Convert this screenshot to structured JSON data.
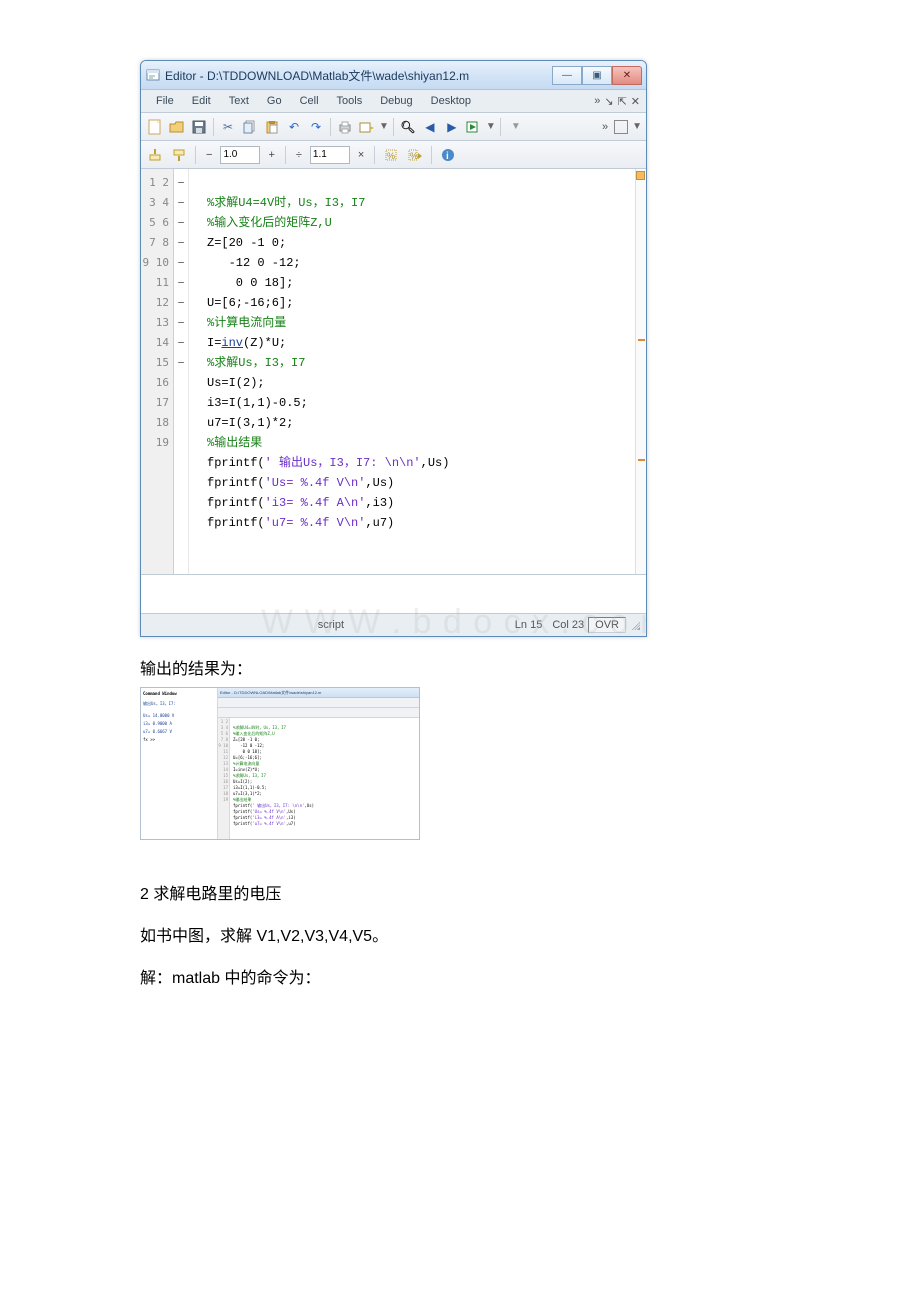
{
  "window": {
    "title": "Editor - D:\\TDDOWNLOAD\\Matlab文件\\wade\\shiyan12.m",
    "menubar": [
      "File",
      "Edit",
      "Text",
      "Go",
      "Cell",
      "Tools",
      "Debug",
      "Desktop"
    ],
    "controls": {
      "minimize": "—",
      "maximize": "▣",
      "close": "✕"
    },
    "toolbar2": {
      "val1": "1.0",
      "val2": "1.1",
      "minus": "−",
      "plus": "+",
      "div": "÷",
      "times": "×"
    },
    "status": {
      "script": "script",
      "ln_label": "Ln",
      "ln": "15",
      "col_label": "Col",
      "col": "23",
      "mode": "OVR"
    }
  },
  "code_lines": [
    {
      "n": "1",
      "fold": "",
      "text": ""
    },
    {
      "n": "2",
      "fold": "",
      "text": "%求解U4=4V时，Us，I3，I7",
      "cls": "comment"
    },
    {
      "n": "3",
      "fold": "",
      "text": "%输入变化后的矩阵Z,U",
      "cls": "comment"
    },
    {
      "n": "4",
      "fold": "−",
      "text": "Z=[20 -1 0;"
    },
    {
      "n": "5",
      "fold": "",
      "text": "   -12 0 -12;"
    },
    {
      "n": "6",
      "fold": "",
      "text": "    0 0 18];"
    },
    {
      "n": "7",
      "fold": "−",
      "text": "U=[6;-16;6];"
    },
    {
      "n": "8",
      "fold": "",
      "text": "%计算电流向量",
      "cls": "comment"
    },
    {
      "n": "9",
      "fold": "−",
      "text": "I=<fn>inv</fn>(Z)*U;"
    },
    {
      "n": "10",
      "fold": "",
      "text": "%求解Us，I3，I7",
      "cls": "comment"
    },
    {
      "n": "11",
      "fold": "−",
      "text": "Us=I(2);"
    },
    {
      "n": "12",
      "fold": "−",
      "text": "i3=I(1,1)-0.5;"
    },
    {
      "n": "13",
      "fold": "−",
      "text": "u7=I(3,1)*2;"
    },
    {
      "n": "14",
      "fold": "",
      "text": "%输出结果",
      "cls": "comment"
    },
    {
      "n": "15",
      "fold": "−",
      "text": "fprintf(<str>' 输出Us，I3，I7: \\n\\n'</str>,Us)"
    },
    {
      "n": "16",
      "fold": "−",
      "text": "fprintf(<str>'Us= %.4f V\\n'</str>,Us)"
    },
    {
      "n": "17",
      "fold": "−",
      "text": "fprintf(<str>'i3= %.4f A\\n'</str>,i3)"
    },
    {
      "n": "18",
      "fold": "−",
      "text": "fprintf(<str>'u7= %.4f V\\n'</str>,u7)"
    },
    {
      "n": "19",
      "fold": "",
      "text": ""
    }
  ],
  "doc": {
    "line1": "输出的结果为：",
    "line2": "2 求解电路里的电压",
    "line3": "如书中图，求解 V1,V2,V3,V4,V5。",
    "line4": "解：matlab 中的命令为："
  },
  "thumb": {
    "cmd_header": "Command Window",
    "cmd_out_header": "输出Us，I3，I7:",
    "cmd_out": [
      "Us= 14.0000 V",
      "i3= 0.9000 A",
      "u7= 0.6667 V"
    ],
    "prompt": "fx >>",
    "title": "Editor - D:\\TDDOWNLOAD\\Matlab文件\\wade\\shiyan12.m"
  }
}
